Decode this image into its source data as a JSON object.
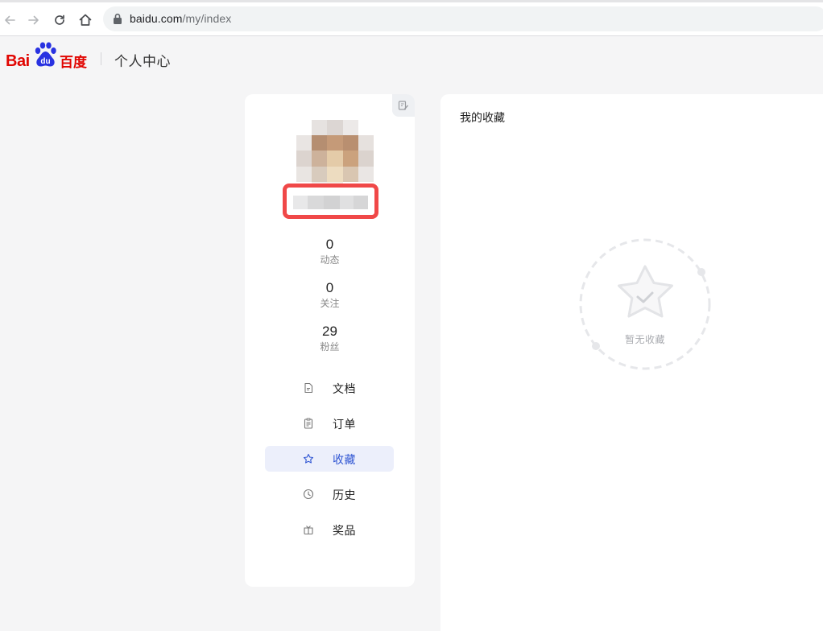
{
  "browser": {
    "url_host": "baidu.com",
    "url_path": "/my/index"
  },
  "header": {
    "logo_latin": "Bai",
    "logo_paw_text": "du",
    "logo_cn": "百度",
    "title": "个人中心"
  },
  "profile": {
    "stats": [
      {
        "value": "0",
        "label": "动态"
      },
      {
        "value": "0",
        "label": "关注"
      },
      {
        "value": "29",
        "label": "粉丝"
      }
    ],
    "menu": [
      {
        "label": "文档",
        "icon": "document-icon",
        "active": false
      },
      {
        "label": "订单",
        "icon": "clipboard-icon",
        "active": false
      },
      {
        "label": "收藏",
        "icon": "star-icon",
        "active": true
      },
      {
        "label": "历史",
        "icon": "clock-icon",
        "active": false
      },
      {
        "label": "奖品",
        "icon": "gift-icon",
        "active": false
      }
    ]
  },
  "content": {
    "title": "我的收藏",
    "empty_text": "暂无收藏"
  },
  "colors": {
    "brand_red": "#e10602",
    "brand_blue": "#2932e1",
    "active_text": "#3056d3",
    "active_bg": "#eceffb",
    "highlight_box": "#f04848"
  }
}
